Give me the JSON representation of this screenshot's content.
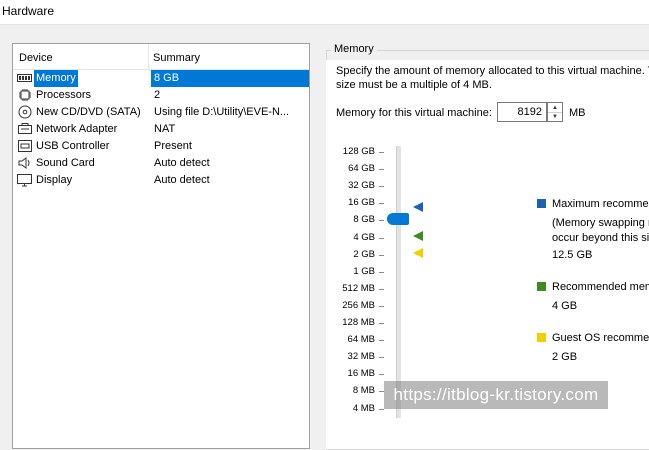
{
  "window": {
    "title": "Hardware"
  },
  "device_list": {
    "headers": {
      "device": "Device",
      "summary": "Summary"
    },
    "rows": [
      {
        "icon": "memory-icon",
        "device": "Memory",
        "summary": "8 GB",
        "selected": true
      },
      {
        "icon": "processor-icon",
        "device": "Processors",
        "summary": "2",
        "selected": false
      },
      {
        "icon": "cd-dvd-icon",
        "device": "New CD/DVD (SATA)",
        "summary": "Using file D:\\Utility\\EVE-N...",
        "selected": false
      },
      {
        "icon": "network-adapter-icon",
        "device": "Network Adapter",
        "summary": "NAT",
        "selected": false
      },
      {
        "icon": "usb-icon",
        "device": "USB Controller",
        "summary": "Present",
        "selected": false
      },
      {
        "icon": "sound-card-icon",
        "device": "Sound Card",
        "summary": "Auto detect",
        "selected": false
      },
      {
        "icon": "display-icon",
        "device": "Display",
        "summary": "Auto detect",
        "selected": false
      }
    ]
  },
  "memory": {
    "group_title": "Memory",
    "description_line1": "Specify the amount of memory allocated to this virtual machine. T",
    "description_line2": "size must be a multiple of 4 MB.",
    "input_label": "Memory for this virtual machine:",
    "value": "8192",
    "unit": "MB",
    "slider_ticks": [
      "128 GB",
      "64 GB",
      "32 GB",
      "16 GB",
      "8 GB",
      "4 GB",
      "2 GB",
      "1 GB",
      "512 MB",
      "256 MB",
      "128 MB",
      "64 MB",
      "32 MB",
      "16 MB",
      "8 MB",
      "4 MB"
    ],
    "current_value": "8 GB",
    "legend": {
      "maximum": {
        "title": "Maximum recommende",
        "note_line1": "(Memory swapping m",
        "note_line2": "occur beyond this siz",
        "value": "12.5 GB",
        "color": "#1c62b3"
      },
      "recommended": {
        "title": "Recommended memo",
        "value": "4 GB",
        "color": "#3c8c21"
      },
      "guest_os": {
        "title": "Guest OS recommen",
        "value": "2 GB",
        "color": "#f0d000"
      }
    }
  },
  "watermark": "https://itblog-kr.tistory.com"
}
